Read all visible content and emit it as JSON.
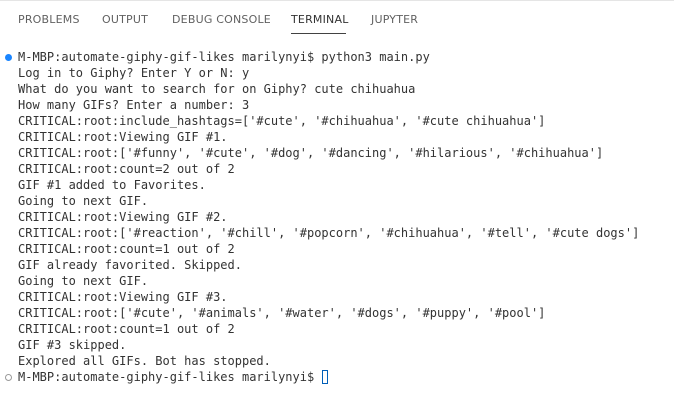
{
  "tabs": [
    {
      "label": "PROBLEMS",
      "active": false
    },
    {
      "label": "OUTPUT",
      "active": false
    },
    {
      "label": "DEBUG CONSOLE",
      "active": false
    },
    {
      "label": "TERMINAL",
      "active": true
    },
    {
      "label": "JUPYTER",
      "active": false
    }
  ],
  "terminal": {
    "lines": [
      "M-MBP:automate-giphy-gif-likes marilynyi$ python3 main.py",
      "Log in to Giphy? Enter Y or N: y",
      "What do you want to search for on Giphy? cute chihuahua",
      "How many GIFs? Enter a number: 3",
      "CRITICAL:root:include_hashtags=['#cute', '#chihuahua', '#cute chihuahua']",
      "CRITICAL:root:Viewing GIF #1.",
      "CRITICAL:root:['#funny', '#cute', '#dog', '#dancing', '#hilarious', '#chihuahua']",
      "CRITICAL:root:count=2 out of 2",
      "GIF #1 added to Favorites.",
      "Going to next GIF.",
      "CRITICAL:root:Viewing GIF #2.",
      "CRITICAL:root:['#reaction', '#chill', '#popcorn', '#chihuahua', '#tell', '#cute dogs']",
      "CRITICAL:root:count=1 out of 2",
      "GIF already favorited. Skipped.",
      "Going to next GIF.",
      "CRITICAL:root:Viewing GIF #3.",
      "CRITICAL:root:['#cute', '#animals', '#water', '#dogs', '#puppy', '#pool']",
      "CRITICAL:root:count=1 out of 2",
      "GIF #3 skipped.",
      "Explored all GIFs. Bot has stopped.",
      "M-MBP:automate-giphy-gif-likes marilynyi$ "
    ]
  },
  "colors": {
    "active_tab_underline": "#424242",
    "command_decoration": "#1a85ff",
    "cursor": "#005fb8"
  }
}
